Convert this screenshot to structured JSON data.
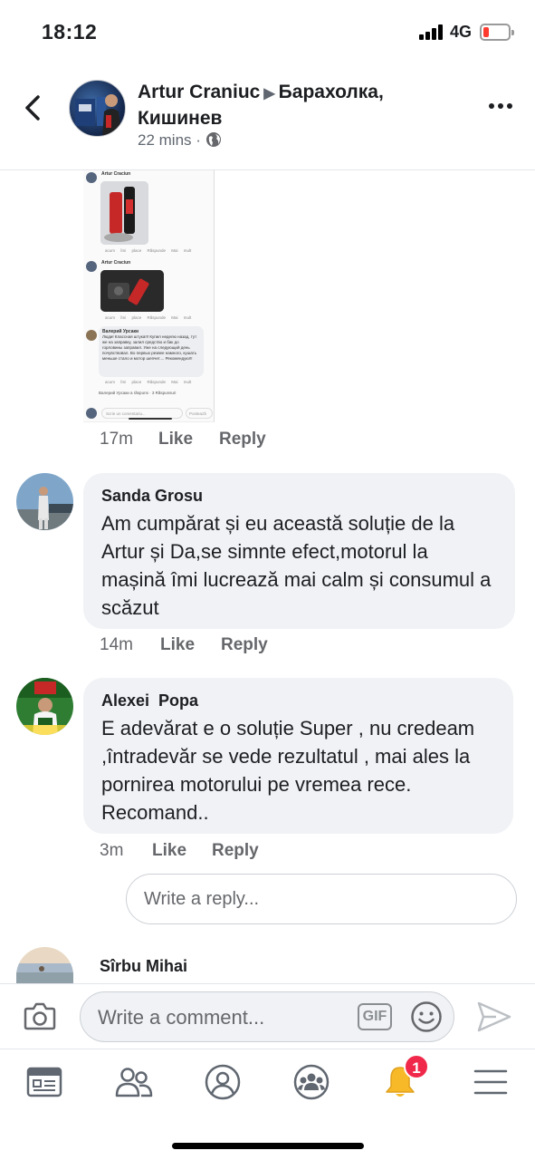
{
  "status_bar": {
    "time": "18:12",
    "network": "4G",
    "battery_level": 0.15
  },
  "header": {
    "author": "Artur Craniuc",
    "group": "Барахолка, Кишинев",
    "time_ago": "22 mins",
    "separator": "·",
    "privacy_icon": "globe-icon"
  },
  "embedded_screenshot": {
    "items": [
      {
        "name": "Artur Craciun",
        "actions": "acum  Îmi place  Răspunde  Mai mult"
      },
      {
        "name": "Artur Craciun",
        "actions": "acum  Îmi place  Răspunde  Mai mult"
      }
    ],
    "comment": {
      "name": "Валерий Урсаки",
      "text": "Люди! Классная штука!!! Купил неделю назад, тут же на заправку, залил средство и бак до горловины заправил. Уже на следующий день почувствовал. Во первых резвее намного, кушать меньше стало и мотор шепчет.... Рекомендую!!!",
      "actions": "acum  Îmi place  Răspunde  Mai mult"
    },
    "reply_line": "Валерий Урсаки a răspuns · 3 Răspunsuri",
    "input_placeholder": "Scrie un comentariu...",
    "input_small": "Postează"
  },
  "post_meta": {
    "time": "17m",
    "like": "Like",
    "reply": "Reply"
  },
  "comments": [
    {
      "name": "Sanda Grosu",
      "text": "Am cumpărat și eu această soluție de la Artur și Da,se simnte efect,motorul la mașină îmi lucrează mai calm și consumul a scăzut",
      "time": "14m",
      "like": "Like",
      "reply": "Reply"
    },
    {
      "name": "Alexei  Popa",
      "text": "E adevărat e o soluție Super , nu credeam ,întradevăr se vede rezultatul , mai ales la pornirea motorului pe vremea rece. Recomand..",
      "time": "3m",
      "like": "Like",
      "reply": "Reply"
    }
  ],
  "reply_box": {
    "placeholder": "Write a reply..."
  },
  "partial_comment": {
    "name": "Sîrbu Mihai"
  },
  "composer": {
    "placeholder": "Write a comment...",
    "gif_label": "GIF"
  },
  "tabbar": {
    "tabs": [
      "news-feed-icon",
      "friends-icon",
      "profile-icon",
      "groups-icon",
      "notifications-icon",
      "menu-icon"
    ],
    "notification_count": "1"
  },
  "colors": {
    "accent": "#1877f2",
    "bubble": "#f0f2f5",
    "secondary_text": "#65676b",
    "badge": "#f02849"
  }
}
